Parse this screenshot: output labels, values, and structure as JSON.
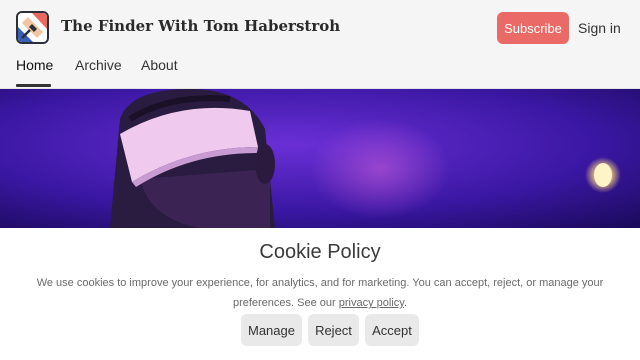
{
  "header": {
    "site_title": "The Finder With Tom Haberstroh",
    "subscribe_label": "Subscribe",
    "signin_label": "Sign in"
  },
  "nav": {
    "items": [
      {
        "label": "Home",
        "active": true
      },
      {
        "label": "Archive",
        "active": false
      },
      {
        "label": "About",
        "active": false
      }
    ]
  },
  "cookie_banner": {
    "title": "Cookie Policy",
    "text_line1": "We use cookies to improve your experience, for analytics, and for marketing. You can accept, reject, or manage your",
    "text_line2_prefix": "preferences. See our ",
    "privacy_link": "privacy policy",
    "text_line2_suffix": ".",
    "buttons": {
      "manage": "Manage",
      "reject": "Reject",
      "accept": "Accept"
    }
  },
  "colors": {
    "accent": "#ea6a67",
    "hero_bg": "#3a16a8",
    "button_bg": "#e9e9e9"
  },
  "icons": {
    "logo": "flashlight-logo-icon"
  }
}
